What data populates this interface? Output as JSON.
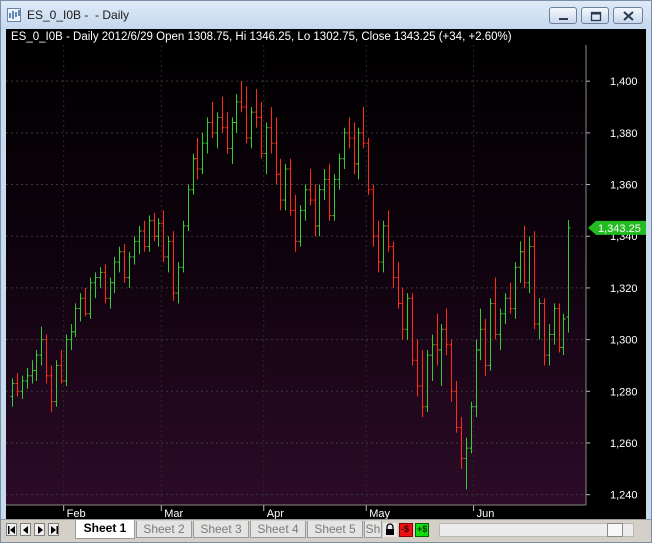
{
  "window": {
    "title": "ES_0_I0B -  - Daily"
  },
  "chart": {
    "header": "ES_0_I0B - Daily 2012/6/29 Open 1308.75, Hi 1346.25, Lo 1302.75, Close 1343.25 (+34, +2.60%)",
    "last_price_label": "1,343.25"
  },
  "colors": {
    "up_bar": "#33cc33",
    "down_bar": "#ff2a1a",
    "last_price_bg": "#22bb22",
    "background_top": "#000000",
    "background_bottom": "#2a0a26"
  },
  "chart_data": {
    "type": "ohlc",
    "symbol": "ES_0_I0B",
    "interval": "Daily",
    "date": "2012/6/29",
    "open": 1308.75,
    "high": 1346.25,
    "low": 1302.75,
    "close": 1343.25,
    "change": 34,
    "change_pct": 2.6,
    "ylim": [
      1236,
      1414
    ],
    "yticks": [
      1240,
      1260,
      1280,
      1300,
      1320,
      1340,
      1360,
      1380,
      1400
    ],
    "ytick_labels": [
      "1,240",
      "1,260",
      "1,280",
      "1,300",
      "1,320",
      "1,340",
      "1,360",
      "1,380",
      "1,400"
    ],
    "months": [
      {
        "label": "Feb",
        "bar_index": 11
      },
      {
        "label": "Mar",
        "bar_index": 31
      },
      {
        "label": "Apr",
        "bar_index": 52
      },
      {
        "label": "May",
        "bar_index": 73
      },
      {
        "label": "Jun",
        "bar_index": 95
      }
    ],
    "grid": true,
    "last_price": 1343.25,
    "bars": [
      [
        1278,
        1285,
        1274,
        1283
      ],
      [
        1283,
        1287,
        1278,
        1280
      ],
      [
        1280,
        1286,
        1277,
        1284
      ],
      [
        1284,
        1289,
        1281,
        1286
      ],
      [
        1286,
        1292,
        1283,
        1288
      ],
      [
        1288,
        1296,
        1284,
        1294
      ],
      [
        1294,
        1305,
        1290,
        1300
      ],
      [
        1300,
        1302,
        1283,
        1286
      ],
      [
        1286,
        1290,
        1272,
        1276
      ],
      [
        1276,
        1292,
        1274,
        1290
      ],
      [
        1290,
        1296,
        1283,
        1284
      ],
      [
        1284,
        1302,
        1282,
        1300
      ],
      [
        1300,
        1306,
        1296,
        1303
      ],
      [
        1303,
        1314,
        1301,
        1312
      ],
      [
        1312,
        1318,
        1307,
        1316
      ],
      [
        1316,
        1320,
        1309,
        1310
      ],
      [
        1310,
        1324,
        1308,
        1322
      ],
      [
        1322,
        1326,
        1316,
        1324
      ],
      [
        1324,
        1328,
        1320,
        1326
      ],
      [
        1326,
        1329,
        1314,
        1316
      ],
      [
        1316,
        1324,
        1312,
        1322
      ],
      [
        1322,
        1332,
        1318,
        1330
      ],
      [
        1330,
        1336,
        1326,
        1334
      ],
      [
        1334,
        1337,
        1322,
        1324
      ],
      [
        1324,
        1334,
        1320,
        1332
      ],
      [
        1332,
        1340,
        1329,
        1338
      ],
      [
        1338,
        1344,
        1333,
        1342
      ],
      [
        1342,
        1346,
        1334,
        1336
      ],
      [
        1336,
        1348,
        1334,
        1346
      ],
      [
        1346,
        1349,
        1338,
        1340
      ],
      [
        1340,
        1347,
        1336,
        1345
      ],
      [
        1345,
        1350,
        1330,
        1332
      ],
      [
        1332,
        1340,
        1326,
        1338
      ],
      [
        1338,
        1342,
        1315,
        1318
      ],
      [
        1318,
        1330,
        1314,
        1328
      ],
      [
        1328,
        1346,
        1326,
        1344
      ],
      [
        1344,
        1360,
        1342,
        1358
      ],
      [
        1358,
        1372,
        1356,
        1370
      ],
      [
        1370,
        1378,
        1362,
        1366
      ],
      [
        1366,
        1380,
        1364,
        1376
      ],
      [
        1376,
        1386,
        1372,
        1384
      ],
      [
        1384,
        1392,
        1378,
        1380
      ],
      [
        1380,
        1388,
        1374,
        1386
      ],
      [
        1386,
        1394,
        1380,
        1382
      ],
      [
        1382,
        1388,
        1372,
        1374
      ],
      [
        1374,
        1386,
        1368,
        1384
      ],
      [
        1384,
        1395,
        1380,
        1392
      ],
      [
        1392,
        1400,
        1388,
        1390
      ],
      [
        1390,
        1398,
        1376,
        1378
      ],
      [
        1378,
        1390,
        1374,
        1388
      ],
      [
        1388,
        1397,
        1382,
        1386
      ],
      [
        1386,
        1392,
        1370,
        1372
      ],
      [
        1372,
        1384,
        1364,
        1382
      ],
      [
        1382,
        1390,
        1372,
        1376
      ],
      [
        1376,
        1386,
        1360,
        1364
      ],
      [
        1364,
        1370,
        1350,
        1354
      ],
      [
        1354,
        1368,
        1350,
        1366
      ],
      [
        1366,
        1370,
        1348,
        1350
      ],
      [
        1350,
        1356,
        1334,
        1338
      ],
      [
        1338,
        1352,
        1336,
        1350
      ],
      [
        1350,
        1360,
        1346,
        1358
      ],
      [
        1358,
        1366,
        1352,
        1354
      ],
      [
        1354,
        1360,
        1340,
        1344
      ],
      [
        1344,
        1360,
        1340,
        1358
      ],
      [
        1358,
        1366,
        1354,
        1362
      ],
      [
        1362,
        1368,
        1346,
        1348
      ],
      [
        1348,
        1364,
        1346,
        1362
      ],
      [
        1362,
        1372,
        1358,
        1370
      ],
      [
        1370,
        1382,
        1366,
        1380
      ],
      [
        1380,
        1386,
        1374,
        1378
      ],
      [
        1378,
        1384,
        1364,
        1368
      ],
      [
        1368,
        1382,
        1362,
        1380
      ],
      [
        1380,
        1390,
        1374,
        1376
      ],
      [
        1376,
        1378,
        1356,
        1358
      ],
      [
        1358,
        1360,
        1336,
        1340
      ],
      [
        1340,
        1346,
        1326,
        1330
      ],
      [
        1330,
        1346,
        1326,
        1344
      ],
      [
        1344,
        1350,
        1334,
        1336
      ],
      [
        1336,
        1338,
        1320,
        1324
      ],
      [
        1324,
        1330,
        1312,
        1314
      ],
      [
        1314,
        1320,
        1300,
        1304
      ],
      [
        1304,
        1318,
        1300,
        1316
      ],
      [
        1316,
        1318,
        1290,
        1292
      ],
      [
        1292,
        1300,
        1278,
        1282
      ],
      [
        1282,
        1296,
        1270,
        1274
      ],
      [
        1274,
        1296,
        1272,
        1294
      ],
      [
        1294,
        1302,
        1284,
        1298
      ],
      [
        1298,
        1310,
        1290,
        1296
      ],
      [
        1296,
        1306,
        1282,
        1304
      ],
      [
        1304,
        1312,
        1294,
        1298
      ],
      [
        1298,
        1300,
        1276,
        1280
      ],
      [
        1280,
        1284,
        1264,
        1266
      ],
      [
        1266,
        1270,
        1250,
        1254
      ],
      [
        1254,
        1262,
        1242,
        1258
      ],
      [
        1258,
        1276,
        1256,
        1274
      ],
      [
        1274,
        1300,
        1270,
        1296
      ],
      [
        1296,
        1312,
        1292,
        1304
      ],
      [
        1304,
        1308,
        1286,
        1290
      ],
      [
        1290,
        1316,
        1288,
        1314
      ],
      [
        1314,
        1324,
        1300,
        1302
      ],
      [
        1302,
        1312,
        1296,
        1310
      ],
      [
        1310,
        1318,
        1306,
        1316
      ],
      [
        1316,
        1322,
        1310,
        1312
      ],
      [
        1312,
        1330,
        1308,
        1328
      ],
      [
        1328,
        1338,
        1322,
        1334
      ],
      [
        1334,
        1344,
        1320,
        1322
      ],
      [
        1322,
        1340,
        1318,
        1336
      ],
      [
        1336,
        1342,
        1304,
        1306
      ],
      [
        1306,
        1316,
        1300,
        1314
      ],
      [
        1314,
        1316,
        1290,
        1294
      ],
      [
        1294,
        1306,
        1290,
        1302
      ],
      [
        1302,
        1314,
        1298,
        1312
      ],
      [
        1312,
        1314,
        1295,
        1297
      ],
      [
        1297,
        1310,
        1294,
        1308
      ],
      [
        1308.75,
        1346.25,
        1302.75,
        1343.25
      ]
    ]
  },
  "bottom_bar": {
    "tabs": [
      {
        "label": "Sheet 1",
        "active": true
      },
      {
        "label": "Sheet 2",
        "active": false
      },
      {
        "label": "Sheet 3",
        "active": false
      },
      {
        "label": "Sheet 4",
        "active": false
      },
      {
        "label": "Sheet 5",
        "active": false
      },
      {
        "label": "Sh",
        "active": false
      }
    ],
    "minus_label": "-$",
    "plus_label": "+$"
  }
}
